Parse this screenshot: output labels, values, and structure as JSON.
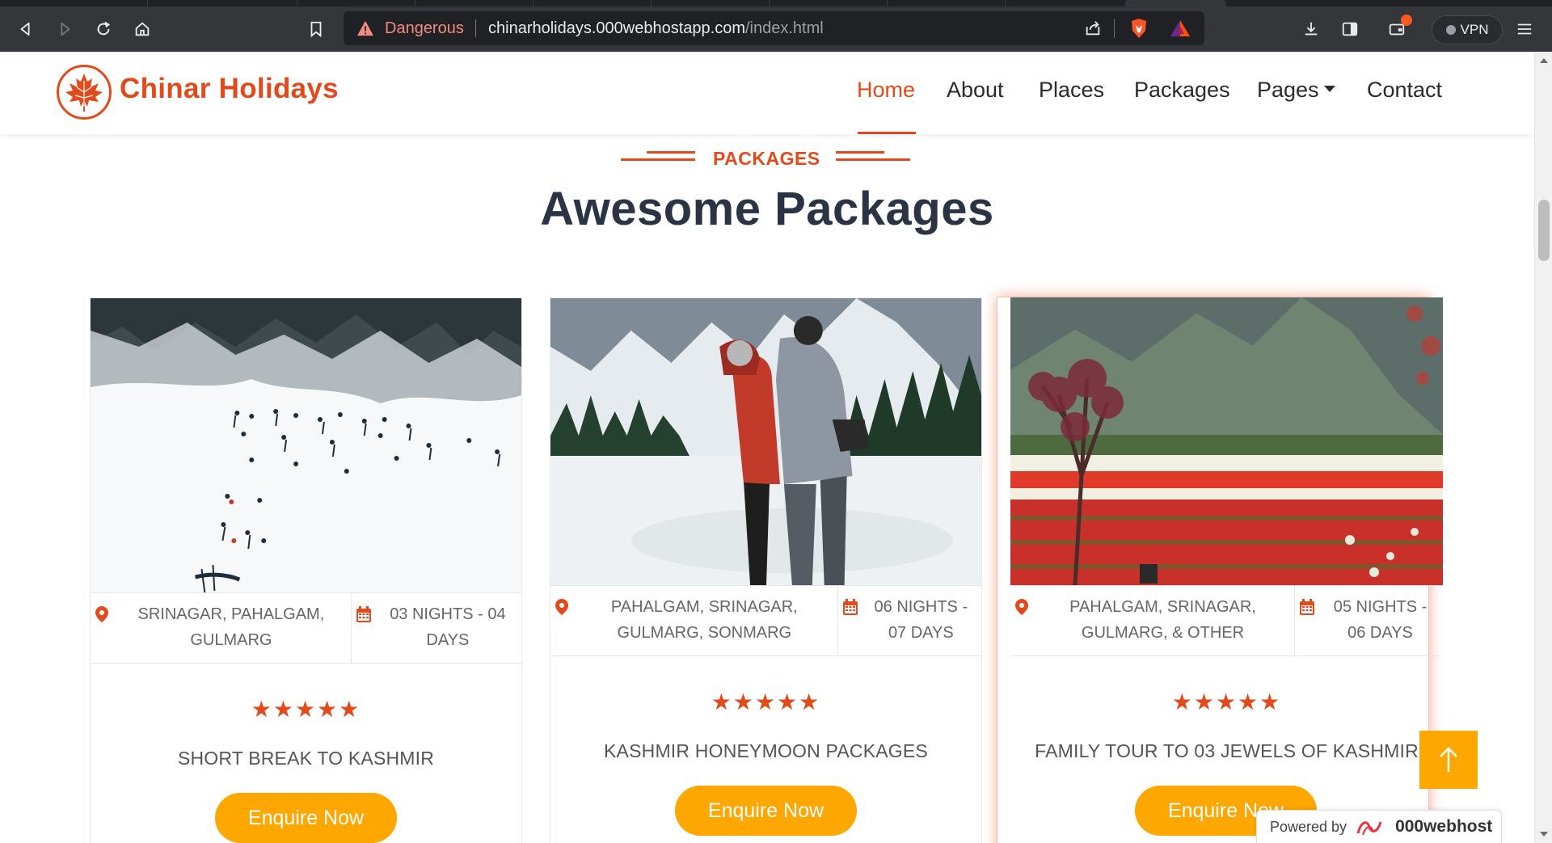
{
  "browser": {
    "security_label": "Dangerous",
    "url_host": "chinarholidays.000webhostapp.com",
    "url_path": "/index.html",
    "vpn_label": "VPN"
  },
  "site": {
    "brand": "Chinar Holidays",
    "nav": [
      {
        "label": "Home"
      },
      {
        "label": "About"
      },
      {
        "label": "Places"
      },
      {
        "label": "Packages"
      },
      {
        "label": "Pages"
      },
      {
        "label": "Contact"
      }
    ]
  },
  "section": {
    "eyebrow": "PACKAGES",
    "title": "Awesome Packages"
  },
  "packages": [
    {
      "location": "SRINAGAR, PAHALGAM, GULMARG",
      "duration": "03 NIGHTS - 04 DAYS",
      "rating": 5,
      "title": "SHORT BREAK TO KASHMIR",
      "cta": "Enquire Now"
    },
    {
      "location": "PAHALGAM, SRINAGAR, GULMARG, SONMARG",
      "duration": "06 NIGHTS - 07 DAYS",
      "rating": 5,
      "title": "KASHMIR HONEYMOON PACKAGES",
      "cta": "Enquire Now"
    },
    {
      "location": "PAHALGAM, SRINAGAR, GULMARG, & OTHER",
      "duration": "05 NIGHTS - 06 DAYS",
      "rating": 5,
      "title": "FAMILY TOUR TO 03 JEWELS OF KASHMIR",
      "cta": "Enquire Now"
    }
  ],
  "stars_text": "★★★★★",
  "footer_badge": {
    "powered_by": "Powered by",
    "host": "000webhost"
  },
  "colors": {
    "accent": "#e24a1c",
    "button": "#fda700",
    "title": "#2b3445"
  }
}
